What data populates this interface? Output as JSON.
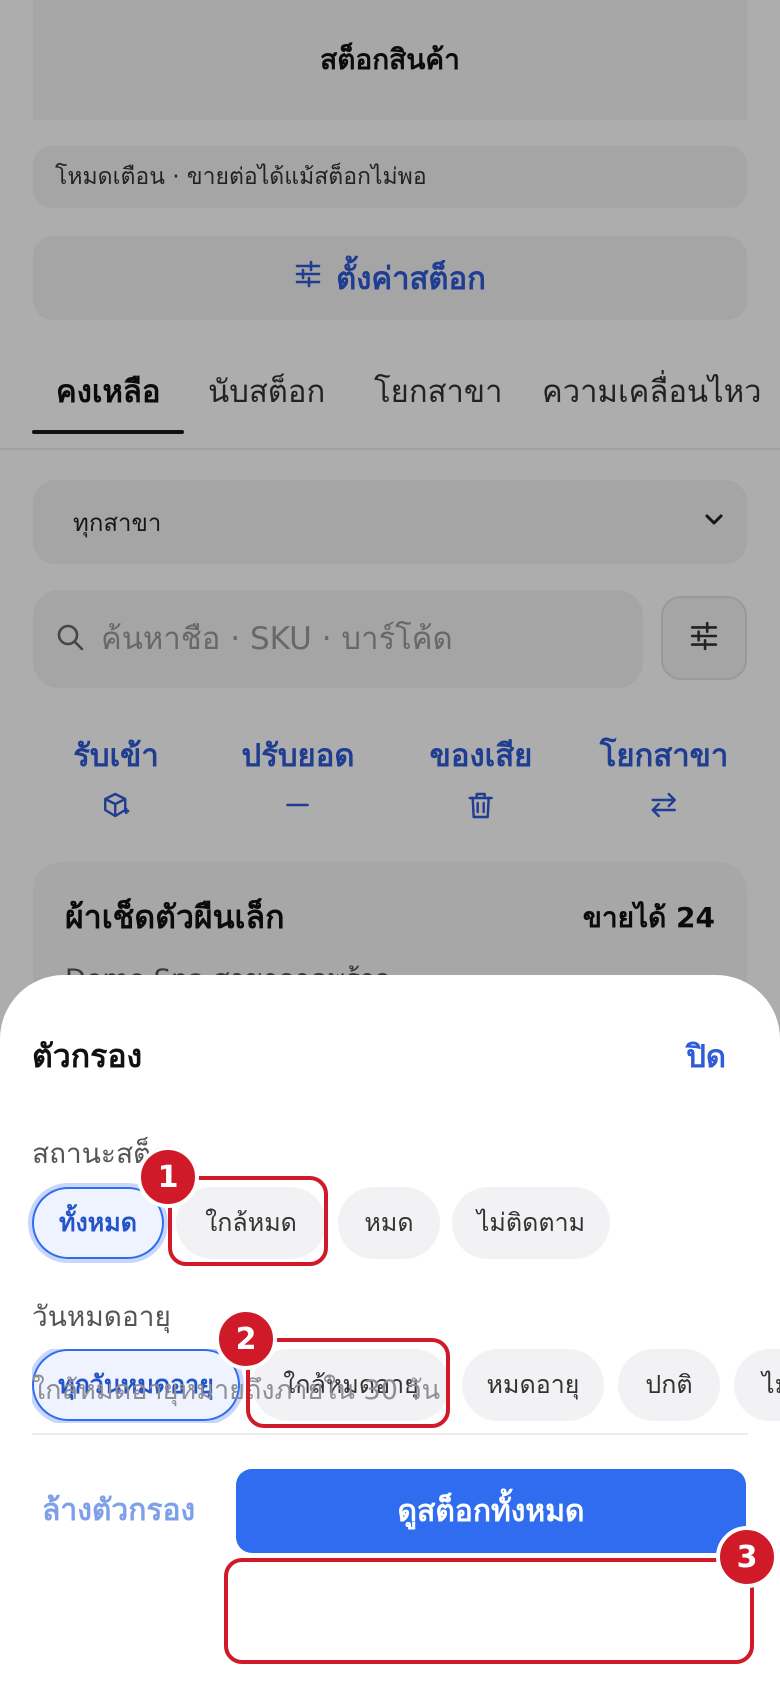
{
  "header": {
    "title": "สต็อกสินค้า"
  },
  "notice": {
    "text": "โหมดเตือน · ขายต่อได้แม้สต็อกไม่พอ"
  },
  "settings_button": {
    "label": "ตั้งค่าสต็อก",
    "icon": "sliders-icon"
  },
  "tabs": [
    {
      "label": "คงเหลือ",
      "active": true
    },
    {
      "label": "นับสต็อก",
      "active": false
    },
    {
      "label": "โยกสาขา",
      "active": false
    },
    {
      "label": "ความเคลื่อนไหว",
      "active": false
    }
  ],
  "branch_select": {
    "value": "ทุกสาขา"
  },
  "search": {
    "placeholder": "ค้นหาชื่อ · SKU · บาร์โค้ด"
  },
  "actions": [
    {
      "label": "รับเข้า",
      "icon": "package-plus-icon"
    },
    {
      "label": "ปรับยอด",
      "icon": "minus-icon"
    },
    {
      "label": "ของเสีย",
      "icon": "trash-icon"
    },
    {
      "label": "โยกสาขา",
      "icon": "transfer-icon"
    }
  ],
  "product_card": {
    "name": "ผ้าเช็ดตัวผืนเล็ก",
    "sale_label": "ขายได้ 24",
    "branch": "Demo Spa สาขาลาดพร้าว"
  },
  "sheet": {
    "title": "ตัวกรอง",
    "close_label": "ปิด",
    "stock_status": {
      "label": "สถานะสต็อก",
      "options": [
        "ทั้งหมด",
        "ใกล้หมด",
        "หมด",
        "ไม่ติดตาม"
      ],
      "selected": "ทั้งหมด"
    },
    "expiry": {
      "label": "วันหมดอายุ",
      "options": [
        "ทุกวันหมดอายุ",
        "ใกล้หมดอายุ",
        "หมดอายุ",
        "ปกติ",
        "ไม่"
      ],
      "selected": "ทุกวันหมดอายุ"
    },
    "hint": "ใกล้หมดอายุหมายถึงภายใน 30 วัน",
    "clear_label": "ล้างตัวกรอง",
    "apply_label": "ดูสต็อกทั้งหมด"
  },
  "annotations": [
    "1",
    "2",
    "3"
  ],
  "colors": {
    "accent": "#2f6cf0",
    "link": "#2f5bd6",
    "annotation": "#d01a2a"
  }
}
